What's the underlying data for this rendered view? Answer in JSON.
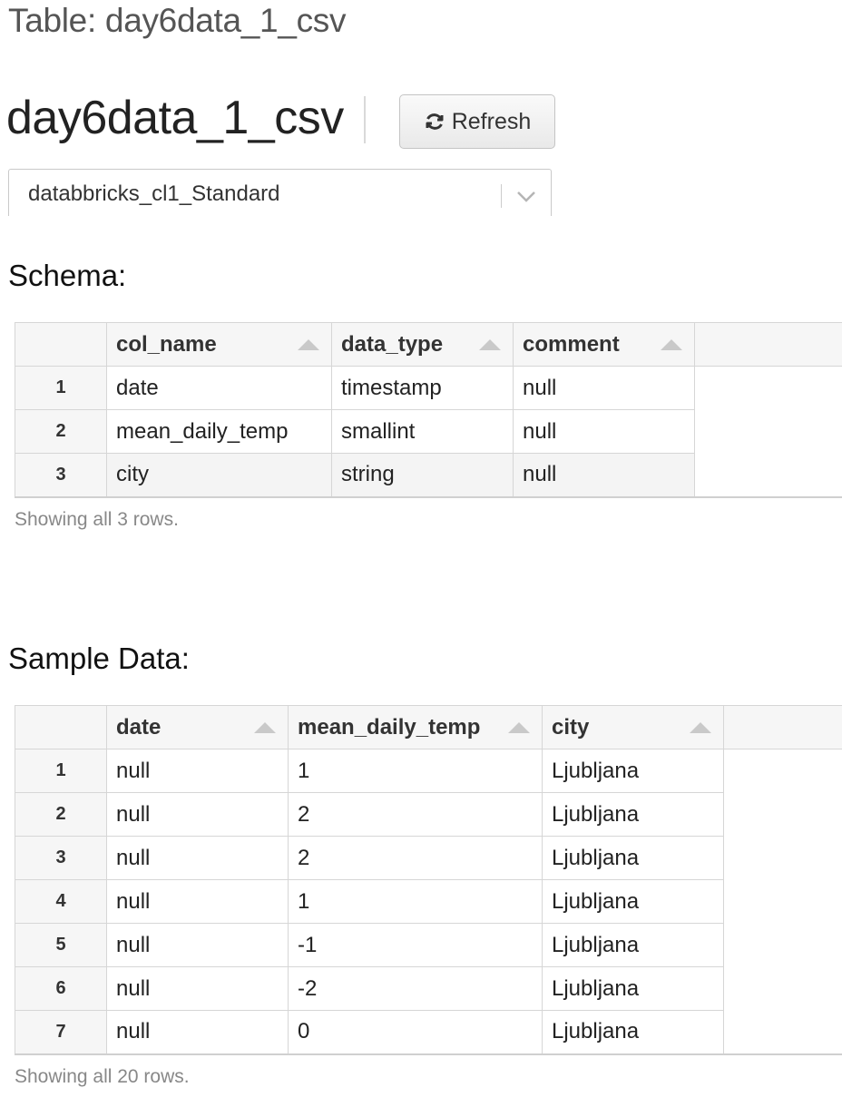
{
  "breadcrumb": "Table: day6data_1_csv",
  "title": "day6data_1_csv",
  "refresh": {
    "label": "Refresh",
    "icon": "refresh-icon"
  },
  "cluster": {
    "selected": "databbricks_cl1_Standard",
    "icon": "chevron-down-icon"
  },
  "schema": {
    "heading": "Schema:",
    "columns": [
      "col_name",
      "data_type",
      "comment"
    ],
    "rows": [
      {
        "idx": "1",
        "cells": [
          "date",
          "timestamp",
          "null"
        ]
      },
      {
        "idx": "2",
        "cells": [
          "mean_daily_temp",
          "smallint",
          "null"
        ]
      },
      {
        "idx": "3",
        "cells": [
          "city",
          "string",
          "null"
        ]
      }
    ],
    "footer": "Showing all 3 rows."
  },
  "sample": {
    "heading": "Sample Data:",
    "columns": [
      "date",
      "mean_daily_temp",
      "city"
    ],
    "rows": [
      {
        "idx": "1",
        "cells": [
          "null",
          "1",
          "Ljubljana"
        ]
      },
      {
        "idx": "2",
        "cells": [
          "null",
          "2",
          "Ljubljana"
        ]
      },
      {
        "idx": "3",
        "cells": [
          "null",
          "2",
          "Ljubljana"
        ]
      },
      {
        "idx": "4",
        "cells": [
          "null",
          "1",
          "Ljubljana"
        ]
      },
      {
        "idx": "5",
        "cells": [
          "null",
          "-1",
          "Ljubljana"
        ]
      },
      {
        "idx": "6",
        "cells": [
          "null",
          "-2",
          "Ljubljana"
        ]
      },
      {
        "idx": "7",
        "cells": [
          "null",
          "0",
          "Ljubljana"
        ]
      }
    ],
    "footer": "Showing all 20 rows."
  },
  "colors": {
    "header_bg": "#f6f6f6",
    "border": "#d6d6d6",
    "muted_text": "#888888"
  }
}
